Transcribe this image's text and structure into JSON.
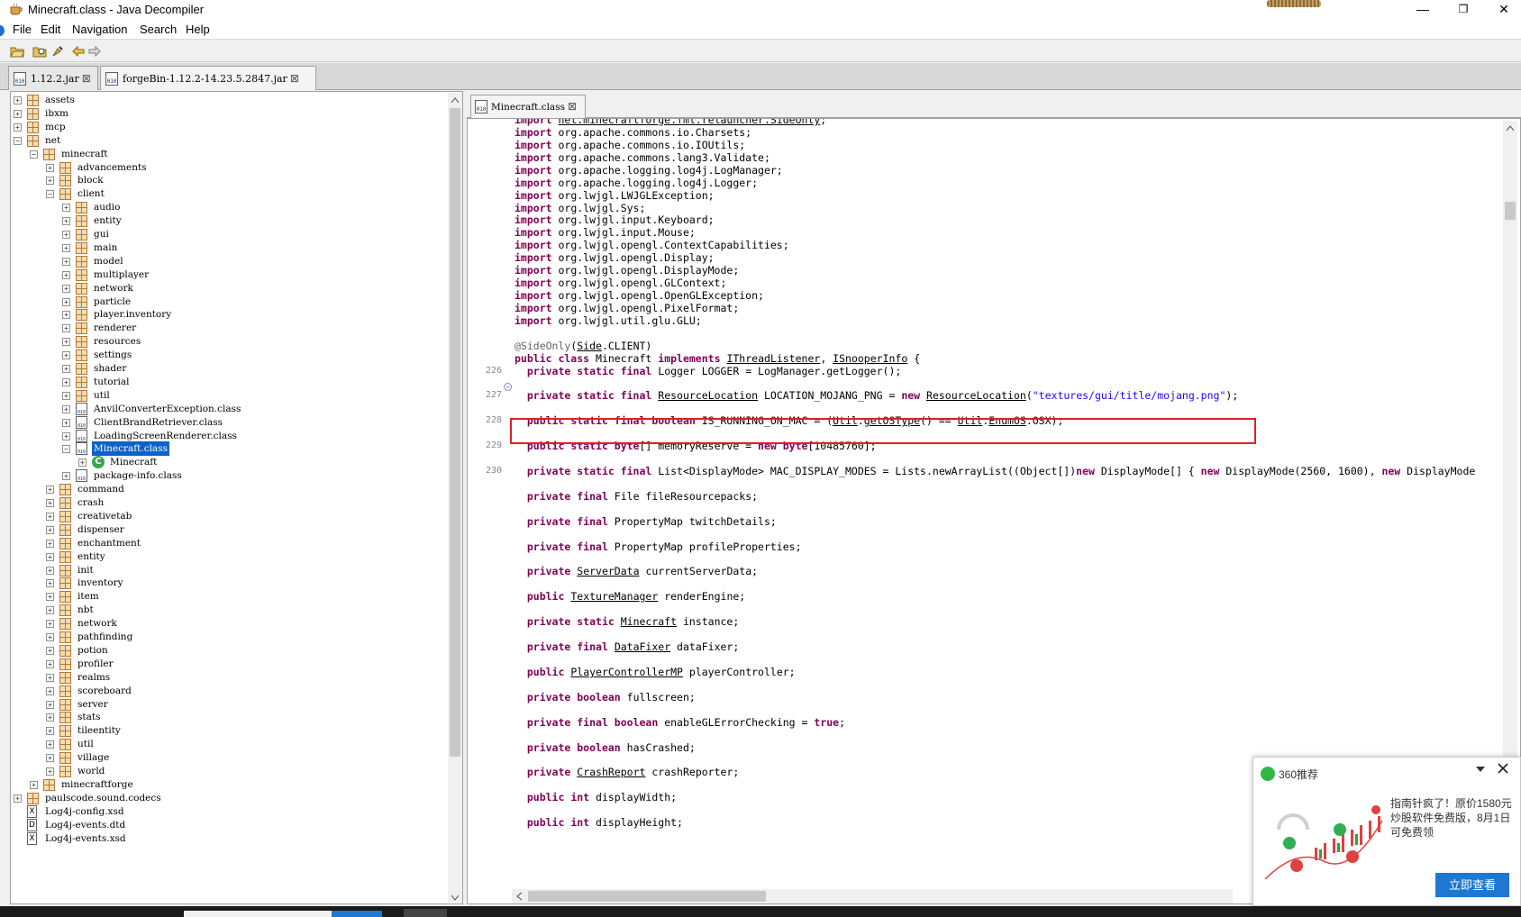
{
  "window": {
    "title": "Minecraft.class - Java Decompiler",
    "minimize": "—",
    "maximize": "❐",
    "close": "✕"
  },
  "menu": {
    "file": "File",
    "edit": "Edit",
    "navigation": "Navigation",
    "search": "Search",
    "help": "Help"
  },
  "file_tabs": [
    {
      "label": "1.12.2.jar",
      "active": false
    },
    {
      "label": "forgeBin-1.12.2-14.23.5.2847.jar",
      "active": true
    }
  ],
  "tree": [
    {
      "label": "assets",
      "depth": 0,
      "kind": "pkg",
      "exp": "+"
    },
    {
      "label": "ibxm",
      "depth": 0,
      "kind": "pkg",
      "exp": "+"
    },
    {
      "label": "mcp",
      "depth": 0,
      "kind": "pkg",
      "exp": "+"
    },
    {
      "label": "net",
      "depth": 0,
      "kind": "pkg",
      "exp": "-"
    },
    {
      "label": "minecraft",
      "depth": 1,
      "kind": "pkg",
      "exp": "-"
    },
    {
      "label": "advancements",
      "depth": 2,
      "kind": "pkg",
      "exp": "+"
    },
    {
      "label": "block",
      "depth": 2,
      "kind": "pkg",
      "exp": "+"
    },
    {
      "label": "client",
      "depth": 2,
      "kind": "pkg",
      "exp": "-"
    },
    {
      "label": "audio",
      "depth": 3,
      "kind": "pkg",
      "exp": "+"
    },
    {
      "label": "entity",
      "depth": 3,
      "kind": "pkg",
      "exp": "+"
    },
    {
      "label": "gui",
      "depth": 3,
      "kind": "pkg",
      "exp": "+"
    },
    {
      "label": "main",
      "depth": 3,
      "kind": "pkg",
      "exp": "+"
    },
    {
      "label": "model",
      "depth": 3,
      "kind": "pkg",
      "exp": "+"
    },
    {
      "label": "multiplayer",
      "depth": 3,
      "kind": "pkg",
      "exp": "+"
    },
    {
      "label": "network",
      "depth": 3,
      "kind": "pkg",
      "exp": "+"
    },
    {
      "label": "particle",
      "depth": 3,
      "kind": "pkg",
      "exp": "+"
    },
    {
      "label": "player.inventory",
      "depth": 3,
      "kind": "pkg",
      "exp": "+"
    },
    {
      "label": "renderer",
      "depth": 3,
      "kind": "pkg",
      "exp": "+"
    },
    {
      "label": "resources",
      "depth": 3,
      "kind": "pkg",
      "exp": "+"
    },
    {
      "label": "settings",
      "depth": 3,
      "kind": "pkg",
      "exp": "+"
    },
    {
      "label": "shader",
      "depth": 3,
      "kind": "pkg",
      "exp": "+"
    },
    {
      "label": "tutorial",
      "depth": 3,
      "kind": "pkg",
      "exp": "+"
    },
    {
      "label": "util",
      "depth": 3,
      "kind": "pkg",
      "exp": "+"
    },
    {
      "label": "AnvilConverterException.class",
      "depth": 3,
      "kind": "cls",
      "exp": "+"
    },
    {
      "label": "ClientBrandRetriever.class",
      "depth": 3,
      "kind": "cls",
      "exp": "+"
    },
    {
      "label": "LoadingScreenRenderer.class",
      "depth": 3,
      "kind": "cls",
      "exp": "+"
    },
    {
      "label": "Minecraft.class",
      "depth": 3,
      "kind": "cls",
      "exp": "-",
      "selected": true
    },
    {
      "label": "Minecraft",
      "depth": 4,
      "kind": "cg",
      "exp": "+"
    },
    {
      "label": "package-info.class",
      "depth": 3,
      "kind": "cls",
      "exp": "+"
    },
    {
      "label": "command",
      "depth": 2,
      "kind": "pkg",
      "exp": "+"
    },
    {
      "label": "crash",
      "depth": 2,
      "kind": "pkg",
      "exp": "+"
    },
    {
      "label": "creativetab",
      "depth": 2,
      "kind": "pkg",
      "exp": "+"
    },
    {
      "label": "dispenser",
      "depth": 2,
      "kind": "pkg",
      "exp": "+"
    },
    {
      "label": "enchantment",
      "depth": 2,
      "kind": "pkg",
      "exp": "+"
    },
    {
      "label": "entity",
      "depth": 2,
      "kind": "pkg",
      "exp": "+"
    },
    {
      "label": "init",
      "depth": 2,
      "kind": "pkg",
      "exp": "+"
    },
    {
      "label": "inventory",
      "depth": 2,
      "kind": "pkg",
      "exp": "+"
    },
    {
      "label": "item",
      "depth": 2,
      "kind": "pkg",
      "exp": "+"
    },
    {
      "label": "nbt",
      "depth": 2,
      "kind": "pkg",
      "exp": "+"
    },
    {
      "label": "network",
      "depth": 2,
      "kind": "pkg",
      "exp": "+"
    },
    {
      "label": "pathfinding",
      "depth": 2,
      "kind": "pkg",
      "exp": "+"
    },
    {
      "label": "potion",
      "depth": 2,
      "kind": "pkg",
      "exp": "+"
    },
    {
      "label": "profiler",
      "depth": 2,
      "kind": "pkg",
      "exp": "+"
    },
    {
      "label": "realms",
      "depth": 2,
      "kind": "pkg",
      "exp": "+"
    },
    {
      "label": "scoreboard",
      "depth": 2,
      "kind": "pkg",
      "exp": "+"
    },
    {
      "label": "server",
      "depth": 2,
      "kind": "pkg",
      "exp": "+"
    },
    {
      "label": "stats",
      "depth": 2,
      "kind": "pkg",
      "exp": "+"
    },
    {
      "label": "tileentity",
      "depth": 2,
      "kind": "pkg",
      "exp": "+"
    },
    {
      "label": "util",
      "depth": 2,
      "kind": "pkg",
      "exp": "+"
    },
    {
      "label": "village",
      "depth": 2,
      "kind": "pkg",
      "exp": "+"
    },
    {
      "label": "world",
      "depth": 2,
      "kind": "pkg",
      "exp": "+"
    },
    {
      "label": "minecraftforge",
      "depth": 1,
      "kind": "pkg",
      "exp": "+"
    },
    {
      "label": "paulscode.sound.codecs",
      "depth": 0,
      "kind": "pkg",
      "exp": "+"
    },
    {
      "label": "Log4j-config.xsd",
      "depth": 0,
      "kind": "xsd",
      "exp": ""
    },
    {
      "label": "Log4j-events.dtd",
      "depth": 0,
      "kind": "dtd",
      "exp": ""
    },
    {
      "label": "Log4j-events.xsd",
      "depth": 0,
      "kind": "xsd",
      "exp": ""
    }
  ],
  "editor_tab": {
    "label": "Minecraft.class"
  },
  "code_lines": [
    {
      "ln": "",
      "html": "<span class='kw'>import</span> <span class='ul'>net.minecraftforge.fml.relauncher.SideOnly</span>;"
    },
    {
      "ln": "",
      "html": "<span class='kw'>import</span> org.apache.commons.io.Charsets;"
    },
    {
      "ln": "",
      "html": "<span class='kw'>import</span> org.apache.commons.io.IOUtils;"
    },
    {
      "ln": "",
      "html": "<span class='kw'>import</span> org.apache.commons.lang3.Validate;"
    },
    {
      "ln": "",
      "html": "<span class='kw'>import</span> org.apache.logging.log4j.LogManager;"
    },
    {
      "ln": "",
      "html": "<span class='kw'>import</span> org.apache.logging.log4j.Logger;"
    },
    {
      "ln": "",
      "html": "<span class='kw'>import</span> org.lwjgl.LWJGLException;"
    },
    {
      "ln": "",
      "html": "<span class='kw'>import</span> org.lwjgl.Sys;"
    },
    {
      "ln": "",
      "html": "<span class='kw'>import</span> org.lwjgl.input.Keyboard;"
    },
    {
      "ln": "",
      "html": "<span class='kw'>import</span> org.lwjgl.input.Mouse;"
    },
    {
      "ln": "",
      "html": "<span class='kw'>import</span> org.lwjgl.opengl.ContextCapabilities;"
    },
    {
      "ln": "",
      "html": "<span class='kw'>import</span> org.lwjgl.opengl.Display;"
    },
    {
      "ln": "",
      "html": "<span class='kw'>import</span> org.lwjgl.opengl.DisplayMode;"
    },
    {
      "ln": "",
      "html": "<span class='kw'>import</span> org.lwjgl.opengl.GLContext;"
    },
    {
      "ln": "",
      "html": "<span class='kw'>import</span> org.lwjgl.opengl.OpenGLException;"
    },
    {
      "ln": "",
      "html": "<span class='kw'>import</span> org.lwjgl.opengl.PixelFormat;"
    },
    {
      "ln": "",
      "html": "<span class='kw'>import</span> org.lwjgl.util.glu.GLU;"
    },
    {
      "ln": "",
      "html": ""
    },
    {
      "ln": "",
      "html": "<span class='anno'>@SideOnly</span>(<span class='ul'>Side</span>.CLIENT)"
    },
    {
      "ln": "",
      "html": "<span class='kw'>public class</span> Minecraft <span class='kw'>implements</span> <span class='ul'>IThreadListener</span>, <span class='ul'>ISnooperInfo</span> {"
    },
    {
      "ln": "226",
      "html": "  <span class='kw'>private static final</span> Logger LOGGER = LogManager.getLogger();"
    },
    {
      "ln": "",
      "html": ""
    },
    {
      "ln": "227",
      "html": "  <span class='kw'>private static final</span> <span class='ul'>ResourceLocation</span> LOCATION_MOJANG_PNG = <span class='kw'>new</span> <span class='ul'>ResourceLocation</span>(<span class='str'>\"textures/gui/title/mojang.png\"</span>);"
    },
    {
      "ln": "",
      "html": ""
    },
    {
      "ln": "228",
      "html": "  <span class='kw'>public static final boolean</span> IS_RUNNING_ON_MAC = (<span class='ul'>Util</span>.<span class='ul'>getOSType</span>() == <span class='ul'>Util</span>.<span class='ul'>EnumOS</span>.OSX);"
    },
    {
      "ln": "",
      "html": ""
    },
    {
      "ln": "229",
      "html": "  <span class='kw'>public static byte</span>[] memoryReserve = <span class='kw'>new byte</span>[10485760];"
    },
    {
      "ln": "",
      "html": ""
    },
    {
      "ln": "230",
      "html": "  <span class='kw'>private static final</span> List&lt;DisplayMode&gt; MAC_DISPLAY_MODES = Lists.newArrayList((Object[])<span class='kw'>new</span> DisplayMode[] { <span class='kw'>new</span> DisplayMode(2560, 1600), <span class='kw'>new</span> DisplayMode"
    },
    {
      "ln": "",
      "html": ""
    },
    {
      "ln": "",
      "html": "  <span class='kw'>private final</span> File fileResourcepacks;"
    },
    {
      "ln": "",
      "html": ""
    },
    {
      "ln": "",
      "html": "  <span class='kw'>private final</span> PropertyMap twitchDetails;"
    },
    {
      "ln": "",
      "html": ""
    },
    {
      "ln": "",
      "html": "  <span class='kw'>private final</span> PropertyMap profileProperties;"
    },
    {
      "ln": "",
      "html": ""
    },
    {
      "ln": "",
      "html": "  <span class='kw'>private</span> <span class='ul'>ServerData</span> currentServerData;"
    },
    {
      "ln": "",
      "html": ""
    },
    {
      "ln": "",
      "html": "  <span class='kw'>public</span> <span class='ul'>TextureManager</span> renderEngine;"
    },
    {
      "ln": "",
      "html": ""
    },
    {
      "ln": "",
      "html": "  <span class='kw'>private static</span> <span class='ul'>Minecraft</span> instance;"
    },
    {
      "ln": "",
      "html": ""
    },
    {
      "ln": "",
      "html": "  <span class='kw'>private final</span> <span class='ul'>DataFixer</span> dataFixer;"
    },
    {
      "ln": "",
      "html": ""
    },
    {
      "ln": "",
      "html": "  <span class='kw'>public</span> <span class='ul'>PlayerControllerMP</span> playerController;"
    },
    {
      "ln": "",
      "html": ""
    },
    {
      "ln": "",
      "html": "  <span class='kw'>private boolean</span> fullscreen;"
    },
    {
      "ln": "",
      "html": ""
    },
    {
      "ln": "",
      "html": "  <span class='kw'>private final boolean</span> enableGLErrorChecking = <span class='kw'>true</span>;"
    },
    {
      "ln": "",
      "html": ""
    },
    {
      "ln": "",
      "html": "  <span class='kw'>private boolean</span> hasCrashed;"
    },
    {
      "ln": "",
      "html": ""
    },
    {
      "ln": "",
      "html": "  <span class='kw'>private</span> <span class='ul'>CrashReport</span> crashReporter;"
    },
    {
      "ln": "",
      "html": ""
    },
    {
      "ln": "",
      "html": "  <span class='kw'>public int</span> displayWidth;"
    },
    {
      "ln": "",
      "html": ""
    },
    {
      "ln": "",
      "html": "  <span class='kw'>public int</span> displayHeight;"
    }
  ],
  "popup": {
    "title": "360推荐",
    "text": "指南针疯了！原价1580元炒股软件免费版，8月1日可免费领",
    "button": "立即查看"
  }
}
